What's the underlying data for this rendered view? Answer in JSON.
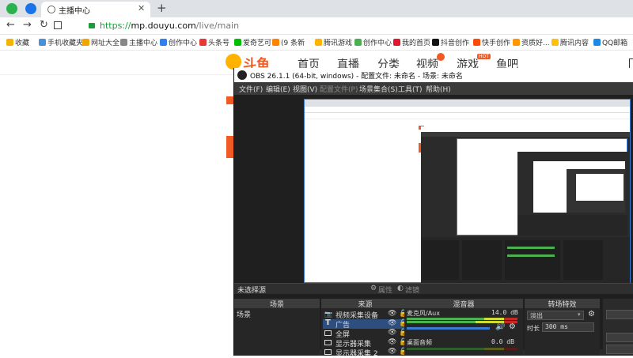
{
  "browser": {
    "tab_title": "主播中心",
    "new_tab": "+",
    "url_scheme": "https://",
    "url_host": "mp.douyu.com",
    "url_path": "/live/main"
  },
  "bookmarks": [
    {
      "label": "收藏",
      "icon": "star-icon",
      "color": "#f5b400"
    },
    {
      "label": "手机收藏夹",
      "icon": "phone-icon",
      "color": "#4a90d9"
    },
    {
      "label": "网址大全",
      "icon": "globe-icon",
      "color": "#f0a500"
    },
    {
      "label": "主播中心",
      "icon": "globe-icon",
      "color": "#888888"
    },
    {
      "label": "创作中心",
      "icon": "creator-icon",
      "color": "#2f80ed"
    },
    {
      "label": "头条号",
      "icon": "toutiao-icon",
      "color": "#e53935"
    },
    {
      "label": "爱奇艺可",
      "icon": "iqiyi-icon",
      "color": "#00be06"
    },
    {
      "label": "(9 条新",
      "icon": "weibo-icon",
      "color": "#ff8200"
    },
    {
      "label": "腾讯游戏",
      "icon": "tencent-icon",
      "color": "#ffb400"
    },
    {
      "label": "创作中心",
      "icon": "shield-icon",
      "color": "#4caf50"
    },
    {
      "label": "我的首页",
      "icon": "weibo-icon",
      "color": "#e6162d"
    },
    {
      "label": "抖音创作",
      "icon": "douyin-icon",
      "color": "#111111"
    },
    {
      "label": "快手创作",
      "icon": "kuaishou-icon",
      "color": "#ff4906"
    },
    {
      "label": "资质好...",
      "icon": "flag-icon",
      "color": "#ff9800"
    },
    {
      "label": "腾讯内容",
      "icon": "tencent-icon",
      "color": "#ffc107"
    },
    {
      "label": "QQ邮箱",
      "icon": "qq-icon",
      "color": "#1e88e5"
    }
  ],
  "douyu": {
    "logo_text": "斗鱼",
    "nav": [
      "首页",
      "直播",
      "分类",
      "视频",
      "游戏",
      "鱼吧"
    ],
    "hot_badge": "HOT"
  },
  "obs": {
    "title": "OBS 26.1.1 (64-bit, windows) - 配置文件: 未命名 - 场景: 未命名",
    "menu": [
      "文件(F)",
      "编辑(E)",
      "视图(V)",
      "配置文件(P)",
      "场景集合(S)",
      "工具(T)",
      "帮助(H)"
    ],
    "no_source": "未选择源",
    "properties": "属性",
    "filters": "滤镜",
    "scenes_header": "场景",
    "scenes": [
      "场景"
    ],
    "sources_header": "来源",
    "sources": [
      "视频采集设备",
      "广告",
      "全屏",
      "显示器采集",
      "显示器采集 2"
    ],
    "mixer_header": "混音器",
    "mixer": [
      {
        "name": "麦克风/Aux",
        "db": "14.0 dB"
      },
      {
        "name": "桌面音频",
        "db": "0.0 dB"
      }
    ],
    "transitions_header": "转场特效",
    "transition": "淡出",
    "duration_label": "时长",
    "duration_value": "300 ms"
  }
}
